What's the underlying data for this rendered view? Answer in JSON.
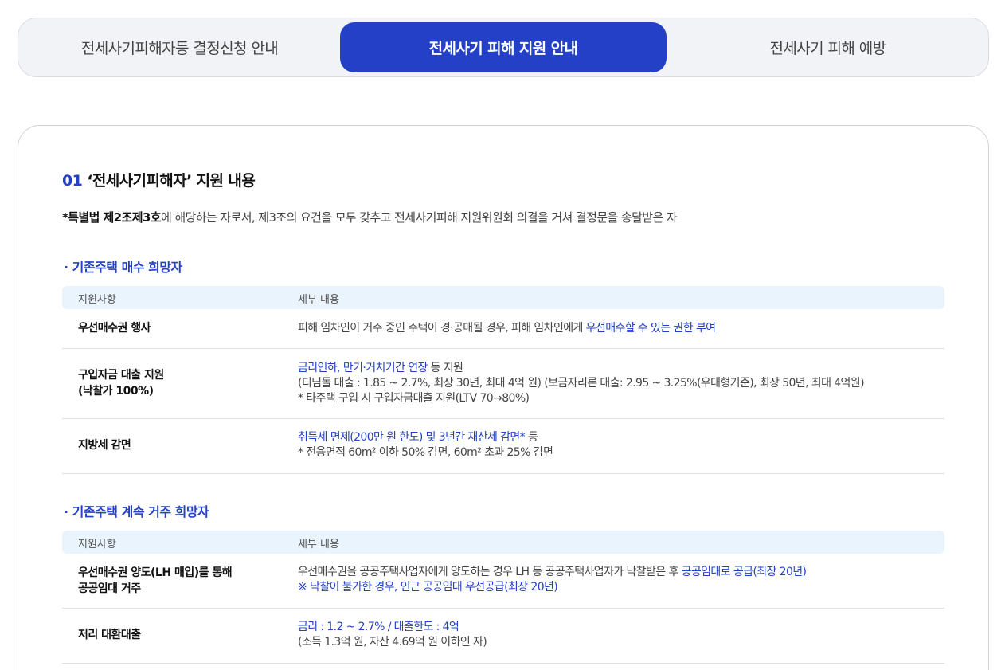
{
  "tabs": [
    {
      "label": "전세사기피해자등 결정신청 안내"
    },
    {
      "label": "전세사기 피해 지원 안내"
    },
    {
      "label": "전세사기 피해 예방"
    }
  ],
  "section": {
    "number": "01",
    "title": "‘전세사기피해자’ 지원 내용",
    "desc_bold": "*특별법 제2조제3호",
    "desc_rest": "에 해당하는 자로서, 제3조의 요건을 모두 갖추고 전세사기피해 지원위원회 의결을 거쳐 결정문을 송달받은 자"
  },
  "table_header": {
    "col1": "지원사항",
    "col2": "세부 내용"
  },
  "group1": {
    "title": "· 기존주택 매수 희망자",
    "rows": [
      {
        "key": "우선매수권 행사",
        "v1a": "피해 임차인이 거주 중인 주택이 경·공매될 경우, 피해 임차인에게 ",
        "v1b": "우선매수할 수 있는 권한 부여"
      },
      {
        "key1": "구입자금 대출 지원",
        "key2": "(낙찰가 100%)",
        "v1a": "금리인하, 만기·거치기간 연장",
        "v1b": " 등 지원",
        "v2": "(디딤돌 대출 : 1.85 ~ 2.7%, 최장 30년, 최대 4억 원) (보금자리론 대출: 2.95 ~ 3.25%(우대형기준), 최장 50년, 최대 4억원)",
        "v3": "* 타주택 구입 시 구입자금대출 지원(LTV 70→80%)"
      },
      {
        "key": "지방세 감면",
        "v1a": "취득세 면제(200만 원 한도) 및 3년간 재산세 감면*",
        "v1b": " 등",
        "v2": "* 전용면적 60m² 이하 50% 감면, 60m² 초과 25% 감면"
      }
    ]
  },
  "group2": {
    "title": "· 기존주택 계속 거주 희망자",
    "rows": [
      {
        "key1": "우선매수권 양도(LH 매입)를 통해",
        "key2": "공공임대 거주",
        "v1a": "우선매수권을 공공주택사업자에게 양도하는 경우 LH 등 공공주택사업자가 낙찰받은 후 ",
        "v1b": "공공임대로 공급(최장 20년)",
        "v2": "※ 낙찰이 불가한 경우, 인근 공공임대 우선공급(최장 20년)"
      },
      {
        "key": "저리 대환대출",
        "v1": "금리 : 1.2 ~ 2.7% / 대출한도 : 4억",
        "v2": "(소득 1.3억 원, 자산 4.69억 원 이하인 자)"
      }
    ]
  }
}
